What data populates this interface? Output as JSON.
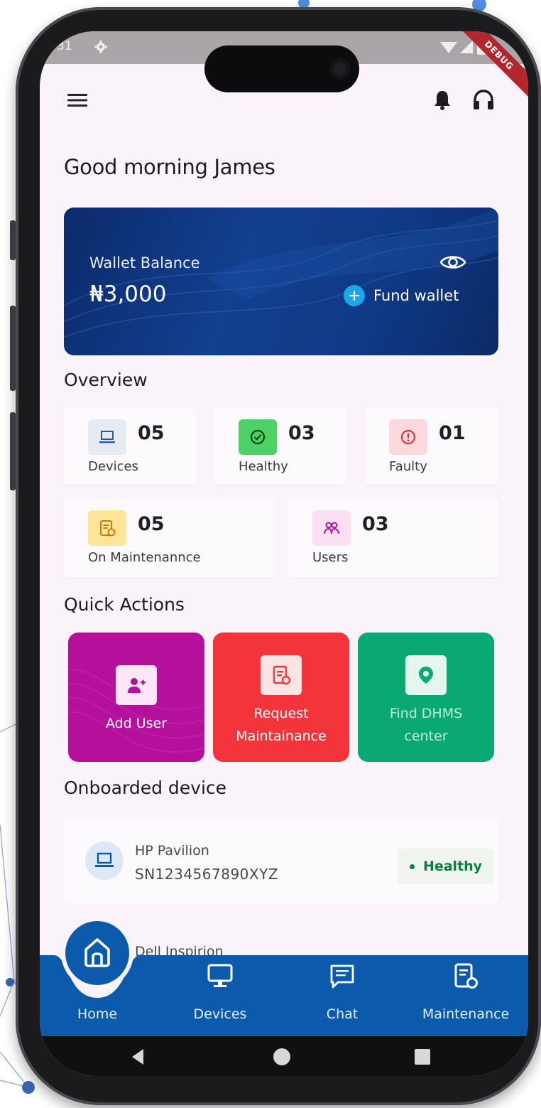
{
  "status_bar": {
    "time": "31",
    "debug_label": "DEBUG"
  },
  "greeting": "Good morning James",
  "wallet": {
    "label": "Wallet Balance",
    "amount": "₦3,000",
    "fund_label": "Fund wallet"
  },
  "overview": {
    "title": "Overview",
    "stats": [
      {
        "value": "05",
        "label": "Devices",
        "icon": "laptop-icon",
        "color": "#e6ebf2"
      },
      {
        "value": "03",
        "label": "Healthy",
        "icon": "check-circle-icon",
        "color": "#4cd164"
      },
      {
        "value": "01",
        "label": "Faulty",
        "icon": "alert-circle-icon",
        "color": "#fbd9dc"
      },
      {
        "value": "05",
        "label": "On Maintenannce",
        "icon": "maintenance-doc-icon",
        "color": "#ffe59a"
      },
      {
        "value": "03",
        "label": "Users",
        "icon": "users-icon",
        "color": "#fbe0f4"
      }
    ]
  },
  "quick_actions": {
    "title": "Quick Actions",
    "items": [
      {
        "label_lines": [
          "Add User"
        ],
        "icon": "add-user-icon",
        "color": "#b5109c"
      },
      {
        "label_lines": [
          "Request",
          "Maintainance"
        ],
        "icon": "maintenance-doc-icon",
        "color": "#f4343b"
      },
      {
        "label_lines": [
          "Find DHMS",
          "center"
        ],
        "icon": "location-pin-icon",
        "color": "#0aa872"
      }
    ]
  },
  "onboarded": {
    "title": "Onboarded device",
    "devices": [
      {
        "name": "HP Pavilion",
        "serial": "SN1234567890XYZ",
        "status": "Healthy",
        "status_color": "#0b7d40"
      },
      {
        "name": "Dell Inspirion"
      }
    ]
  },
  "bottom_nav": {
    "items": [
      {
        "label": "Home",
        "icon": "home-icon",
        "active": true
      },
      {
        "label": "Devices",
        "icon": "monitor-icon"
      },
      {
        "label": "Chat",
        "icon": "chat-icon"
      },
      {
        "label": "Maintenance",
        "icon": "maintenance-doc-icon"
      }
    ],
    "color": "#0c5aab"
  }
}
